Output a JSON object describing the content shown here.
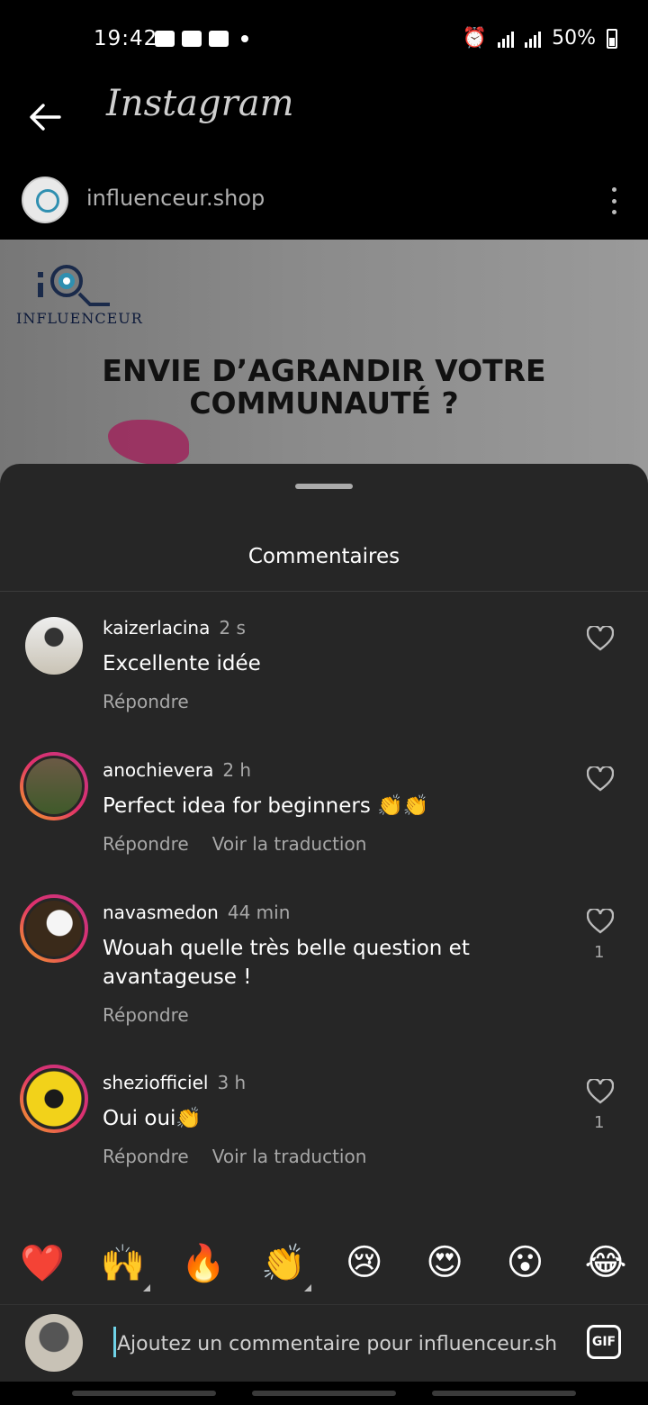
{
  "status_bar": {
    "time": "19:42",
    "battery": "50%"
  },
  "app": {
    "title": "Instagram"
  },
  "post": {
    "account": "influenceur.shop",
    "image": {
      "logo_text": "INFLUENCEUR",
      "headline_line1": "ENVIE D’AGRANDIR VOTRE",
      "headline_line2": "COMMUNAUTÉ ?"
    }
  },
  "comments_sheet": {
    "title": "Commentaires",
    "reply_label": "Répondre",
    "translate_label": "Voir la traduction",
    "comments": [
      {
        "user": "kaizerlacina",
        "time": "2 s",
        "text": "Excellente idée",
        "likes": ""
      },
      {
        "user": "anochievera",
        "time": "2 h",
        "text": "Perfect idea for beginners 👏👏",
        "likes": ""
      },
      {
        "user": "navasmedon",
        "time": "44 min",
        "text": "Wouah quelle très belle question et avantageuse !",
        "likes": "1"
      },
      {
        "user": "sheziofficiel",
        "time": "3 h",
        "text": "Oui oui👏",
        "likes": "1"
      }
    ]
  },
  "emoji_bar": [
    "❤️",
    "🙌",
    "🔥",
    "👏",
    "😢",
    "😍",
    "😮",
    "😂"
  ],
  "composer": {
    "placeholder": "Ajoutez un commentaire pour influenceur.sh",
    "gif_label": "GIF"
  }
}
